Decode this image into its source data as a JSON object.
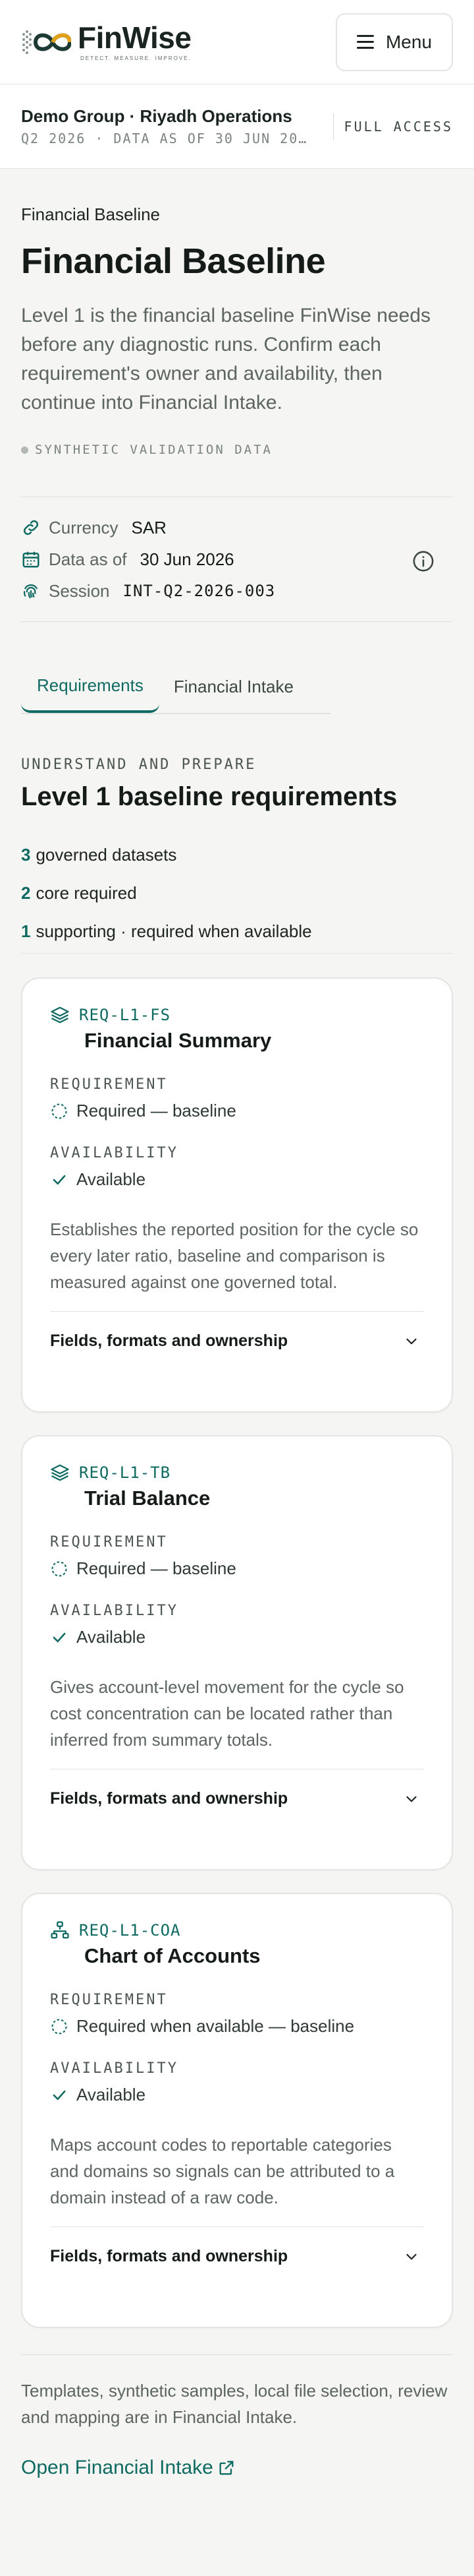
{
  "brand": {
    "name": "FinWise",
    "tagline": "DETECT. MEASURE. IMPROVE.",
    "accent": "#0f6b62"
  },
  "header": {
    "menu_label": "Menu"
  },
  "context": {
    "title": "Demo Group · Riyadh Operations",
    "subtitle": "Q2 2026 · DATA AS OF 30 JUN 20…",
    "access": "FULL ACCESS"
  },
  "page": {
    "breadcrumb": "Financial Baseline",
    "title": "Financial Baseline",
    "lead": "Level 1 is the financial baseline FinWise needs before any diagnostic runs. Confirm each requirement's owner and availability, then continue into Financial Intake.",
    "synthetic_label": "SYNTHETIC VALIDATION DATA"
  },
  "meta": {
    "currency_label": "Currency",
    "currency_value": "SAR",
    "asof_label": "Data as of",
    "asof_value": "30 Jun 2026",
    "session_label": "Session",
    "session_value": "INT-Q2-2026-003"
  },
  "tabs": [
    {
      "label": "Requirements",
      "active": true
    },
    {
      "label": "Financial Intake",
      "active": false
    }
  ],
  "section": {
    "eyebrow": "UNDERSTAND AND PREPARE",
    "title": "Level 1 baseline requirements",
    "stats": [
      {
        "num": "3",
        "text": "governed datasets"
      },
      {
        "num": "2",
        "text": "core required"
      },
      {
        "num": "1",
        "text": "supporting · required when available"
      }
    ]
  },
  "cards": [
    {
      "code": "REQ-L1-FS",
      "title": "Financial Summary",
      "requirement_label": "REQUIREMENT",
      "requirement_value": "Required — baseline",
      "availability_label": "AVAILABILITY",
      "availability_value": "Available",
      "description": "Establishes the reported position for the cycle so every later ratio, baseline and comparison is measured against one governed total.",
      "accordion_label": "Fields, formats and ownership",
      "icon": "layers-icon"
    },
    {
      "code": "REQ-L1-TB",
      "title": "Trial Balance",
      "requirement_label": "REQUIREMENT",
      "requirement_value": "Required — baseline",
      "availability_label": "AVAILABILITY",
      "availability_value": "Available",
      "description": "Gives account-level movement for the cycle so cost concentration can be located rather than inferred from summary totals.",
      "accordion_label": "Fields, formats and ownership",
      "icon": "layers-icon"
    },
    {
      "code": "REQ-L1-COA",
      "title": "Chart of Accounts",
      "requirement_label": "REQUIREMENT",
      "requirement_value": "Required when available — baseline",
      "availability_label": "AVAILABILITY",
      "availability_value": "Available",
      "description": "Maps account codes to reportable categories and domains so signals can be attributed to a domain instead of a raw code.",
      "accordion_label": "Fields, formats and ownership",
      "icon": "hierarchy-icon"
    }
  ],
  "footer": {
    "note": "Templates, synthetic samples, local file selection, review and mapping are in Financial Intake.",
    "link_label": "Open Financial Intake"
  }
}
